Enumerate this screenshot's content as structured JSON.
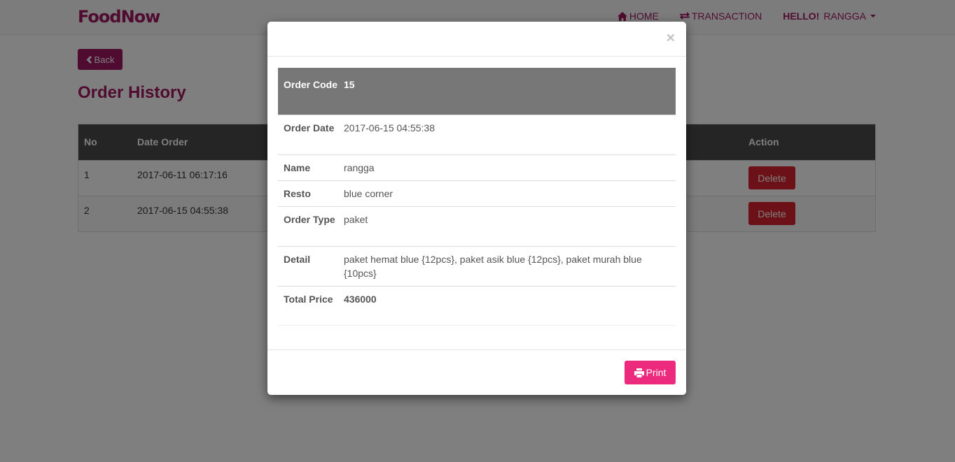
{
  "navbar": {
    "brand": "FoodNow",
    "home_label": "HOME",
    "transaction_label": "TRANSACTION",
    "hello": "HELLO!",
    "username": "RANGGA"
  },
  "page": {
    "back_label": "Back",
    "title": "Order History"
  },
  "orders_table": {
    "headers": {
      "no": "No",
      "date": "Date Order",
      "action": "Action"
    },
    "rows": [
      {
        "no": "1",
        "date": "2017-06-11 06:17:16",
        "delete_label": "Delete"
      },
      {
        "no": "2",
        "date": "2017-06-15 04:55:38",
        "delete_label": "Delete"
      }
    ]
  },
  "modal": {
    "close_symbol": "×",
    "details": {
      "order_code_label": "Order Code",
      "order_code": "15",
      "order_date_label": "Order Date",
      "order_date": "2017-06-15 04:55:38",
      "name_label": "Name",
      "name": "rangga",
      "resto_label": "Resto",
      "resto": "blue corner",
      "order_type_label": "Order Type",
      "order_type": "paket",
      "detail_label": "Detail",
      "detail": "paket hemat blue {12pcs}, paket asik blue {12pcs}, paket murah blue {10pcs}",
      "total_price_label": "Total Price",
      "total_price": "436000"
    },
    "print_label": "Print"
  },
  "colors": {
    "brand": "#a01860",
    "delete": "#d9232f",
    "print": "#ec2a7e",
    "table_header": "#4a4a4a",
    "modal_header_row": "#777777"
  },
  "icons": {
    "home": "home-icon",
    "transaction": "transfer-icon",
    "back": "chevron-left-icon",
    "print": "printer-icon"
  }
}
